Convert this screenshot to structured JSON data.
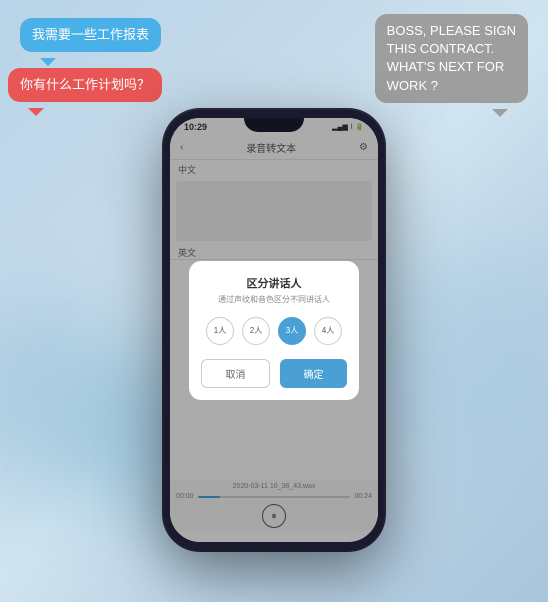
{
  "background": {
    "color_start": "#b8d4e8",
    "color_end": "#a8c5dc"
  },
  "bubble_blue": {
    "line1": "我需要一些工作报表",
    "line2": ""
  },
  "bubble_red": {
    "text": "你有什么工作计划吗？"
  },
  "bubble_gray": {
    "line1": "BOSS, PLEASE SIGN",
    "line2": "THIS CONTRACT.",
    "line3": "WHAT'S NEXT FOR",
    "line4": "WORK ?"
  },
  "phone": {
    "status_bar": {
      "time": "10:29",
      "signal": "▂▄▆",
      "wifi": "wifi",
      "battery": "60%"
    },
    "header": {
      "back_icon": "‹",
      "title": "录音转文本",
      "settings_icon": "⚙"
    },
    "content": {
      "lang_chinese": "中文",
      "lang_english": "英文"
    },
    "modal": {
      "title": "区分讲话人",
      "subtitle": "通过声纹和音色区分不同讲话人",
      "options": [
        "1人",
        "2人",
        "3人",
        "4人"
      ],
      "active_index": 2,
      "cancel_label": "取消",
      "confirm_label": "确定"
    },
    "player": {
      "file_name": "2020-03-11 10_38_43.wav",
      "time_current": "00:00",
      "time_total": "00:24",
      "progress_percent": 15
    },
    "toolbar": {
      "icon_edit": "✏",
      "icon_refresh": "↺",
      "icon_volume": "♪",
      "icon_save": "□",
      "icon_share": "⊕"
    }
  }
}
